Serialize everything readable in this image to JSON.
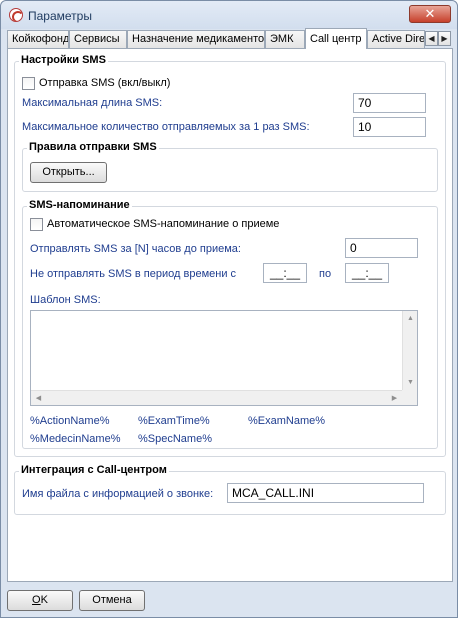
{
  "window": {
    "title": "Параметры",
    "close_glyph": "✕"
  },
  "tabs": [
    {
      "label": "Койкофонд"
    },
    {
      "label": "Сервисы"
    },
    {
      "label": "Назначение медикаментов"
    },
    {
      "label": "ЭМК"
    },
    {
      "label": "Call центр",
      "active": true
    },
    {
      "label": "Active Direc"
    }
  ],
  "tab_scroll": {
    "left": "◀",
    "right": "▶"
  },
  "sms_settings": {
    "title": "Настройки SMS",
    "enable_label": "Отправка SMS (вкл/выкл)",
    "enable_checked": false,
    "max_length_label": "Максимальная длина SMS:",
    "max_length_value": "70",
    "max_count_label": "Максимальное количество отправляемых за 1 раз SMS:",
    "max_count_value": "10",
    "rules": {
      "title": "Правила отправки SMS",
      "open_button": "Открыть..."
    },
    "reminder": {
      "title": "SMS-напоминание",
      "auto_label": "Автоматическое SMS-напоминание о приеме",
      "auto_checked": false,
      "hours_label": "Отправлять SMS за [N] часов до приема:",
      "hours_value": "0",
      "quiet_label": "Не отправлять SMS в период времени с",
      "quiet_from": "__:__",
      "quiet_to_label": "по",
      "quiet_to": "__:__",
      "template_label": "Шаблон SMS:",
      "template_value": "",
      "variables": [
        "%ActionName%",
        "%ExamTime%",
        "%ExamName%",
        "%MedecinName%",
        "%SpecName%"
      ]
    }
  },
  "call_center": {
    "title": "Интеграция с Call-центром",
    "file_label": "Имя файла с информацией о звонке:",
    "file_value": "MCA_CALL.INI"
  },
  "buttons": {
    "ok_hotkey": "O",
    "ok_rest": "K",
    "cancel": "Отмена"
  }
}
